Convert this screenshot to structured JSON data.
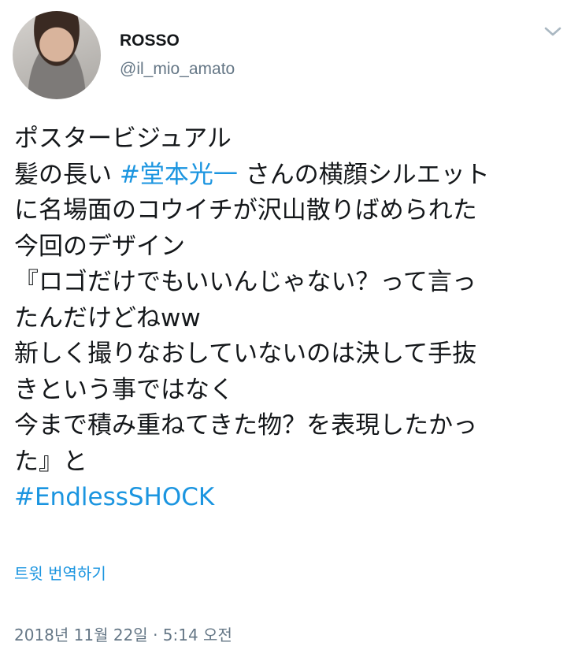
{
  "user": {
    "name": "ROSSO",
    "handle": "@il_mio_amato"
  },
  "icons": {
    "caret": "chevron-down-icon"
  },
  "tweet": {
    "line1": "ポスタービジュアル",
    "line2_pre": "髪の長い ",
    "line2_hashtag": "#堂本光一",
    "line2_post": " さんの横顔シルエット",
    "line3": "に名場面のコウイチが沢山散りばめられた",
    "line4": "今回のデザイン",
    "line5": "『ロゴだけでもいいんじゃない？って言っ",
    "line6": "たんだけどねww",
    "line7": "新しく撮りなおしていないのは決して手抜",
    "line8": "きという事ではなく",
    "line9": "今まで積み重ねてきた物？を表現したかっ",
    "line10": "た』と",
    "hashtag2": "#EndlessSHOCK"
  },
  "translate_label": "트윗 번역하기",
  "timestamp": "2018년 11월 22일 · 5:14 오전",
  "colors": {
    "link": "#1b95e0",
    "secondary_text": "#657786",
    "primary_text": "#14171a"
  }
}
